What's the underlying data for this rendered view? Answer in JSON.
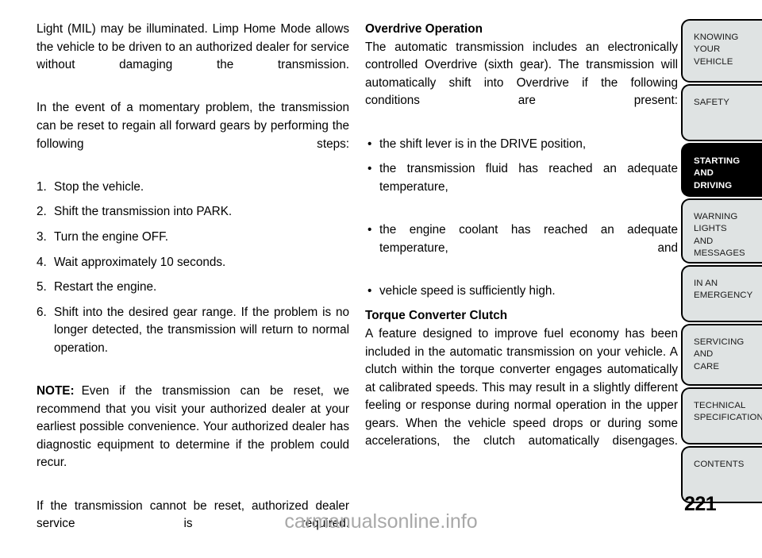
{
  "document": {
    "page_number": "221",
    "watermark": "carmanualsonline.info"
  },
  "left_column": {
    "paragraph_1": "Light (MIL) may be illuminated. Limp Home Mode allows the vehicle to be driven to an authorized dealer for service without damaging the transmission.",
    "paragraph_2": "In the event of a momentary problem, the transmission can be reset to regain all forward gears by performing the following steps:",
    "steps": [
      {
        "number": "1.",
        "text": "Stop the vehicle."
      },
      {
        "number": "2.",
        "text": "Shift the transmission into PARK."
      },
      {
        "number": "3.",
        "text": "Turn the engine OFF."
      },
      {
        "number": "4.",
        "text": "Wait approximately 10 seconds."
      },
      {
        "number": "5.",
        "text": "Restart the engine."
      },
      {
        "number": "6.",
        "text": "Shift into the desired gear range. If the problem is no longer detected, the transmission will return to normal operation."
      }
    ],
    "note_label": "NOTE:",
    "note_text": "Even if the transmission can be reset, we recommend that you visit your authorized dealer at your earliest possible convenience. Your authorized dealer has diagnostic equipment to determine if the problem could recur.",
    "paragraph_3": "If the transmission cannot be reset, authorized dealer service is required."
  },
  "right_column": {
    "heading_1": "Overdrive Operation",
    "paragraph_1": "The automatic transmission includes an electronically controlled Overdrive (sixth gear). The transmission will automatically shift into Overdrive if the following conditions are present:",
    "bullets": [
      "the shift lever is in the DRIVE position,",
      "the transmission fluid has reached an adequate temperature,",
      "the engine coolant has reached an adequate temperature, and",
      "vehicle speed is sufficiently high."
    ],
    "bullet_glyph": "•",
    "heading_2": "Torque Converter Clutch",
    "paragraph_2": "A feature designed to improve fuel economy has been included in the automatic transmission on your vehicle. A clutch within the torque converter engages automatically at calibrated speeds. This may result in a slightly different feeling or response during normal operation in the upper gears. When the vehicle speed drops or during some accelerations, the clutch automatically disengages."
  },
  "sidebar": {
    "active_index": 2,
    "colors": {
      "tab_background": "#dfe3e3",
      "tab_border": "#000000",
      "active_background": "#000000",
      "active_text": "#ffffff"
    },
    "tabs": [
      {
        "lines": [
          "KNOWING",
          "YOUR",
          "VEHICLE"
        ]
      },
      {
        "lines": [
          "SAFETY"
        ]
      },
      {
        "lines": [
          "STARTING",
          "AND",
          "DRIVING"
        ]
      },
      {
        "lines": [
          "WARNING",
          "LIGHTS",
          "AND",
          "MESSAGES"
        ]
      },
      {
        "lines": [
          "IN AN",
          "EMERGENCY"
        ]
      },
      {
        "lines": [
          "SERVICING",
          "AND",
          "CARE"
        ]
      },
      {
        "lines": [
          "TECHNICAL",
          "SPECIFICATIONS"
        ]
      },
      {
        "lines": [
          "CONTENTS"
        ]
      }
    ]
  }
}
